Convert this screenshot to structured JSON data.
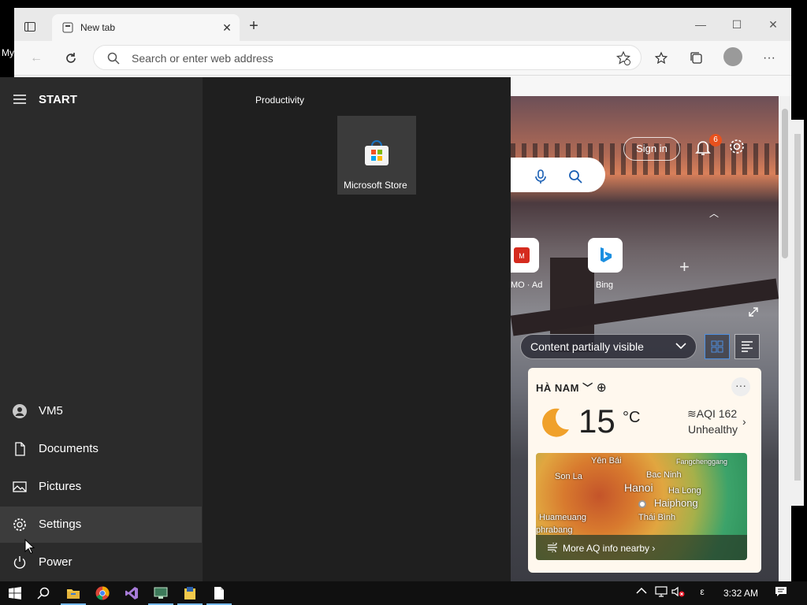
{
  "desktop": {
    "label_fragment": "My"
  },
  "browser": {
    "tab": {
      "title": "New tab"
    },
    "window_controls": {
      "minimize": "—",
      "maximize": "☐",
      "close": "✕"
    },
    "address_bar": {
      "placeholder": "Search or enter web address"
    },
    "page": {
      "sign_in": "Sign in",
      "notification_count": "6",
      "quick_links": [
        {
          "label": "MO · Ad"
        },
        {
          "label": "Bing"
        }
      ],
      "add_link": "+",
      "content_visibility": "Content partially visible",
      "weather": {
        "location": "HÀ NAM",
        "temperature": "15",
        "unit": "°C",
        "aqi": "AQI 162",
        "aqi_status": "Unhealthy",
        "more": "···",
        "map_labels": [
          "Yên Bái",
          "Fangchenggang",
          "Son La",
          "Bac Ninh",
          "Hanoi",
          "Ha Long",
          "Haiphong",
          "Huameuang",
          "Thái Bình",
          "phrabang"
        ],
        "map_cta": "More AQ info nearby ›"
      }
    }
  },
  "start_menu": {
    "title": "START",
    "group": "Productivity",
    "apps": [
      {
        "label": "Microsoft Store"
      }
    ],
    "items": [
      {
        "label": "VM5",
        "icon": "user-icon"
      },
      {
        "label": "Documents",
        "icon": "document-icon"
      },
      {
        "label": "Pictures",
        "icon": "pictures-icon"
      },
      {
        "label": "Settings",
        "icon": "gear-icon"
      },
      {
        "label": "Power",
        "icon": "power-icon"
      }
    ]
  },
  "taskbar": {
    "clock": "3:32 AM",
    "ime": "ε",
    "apps": [
      "start",
      "search",
      "file-explorer",
      "chrome",
      "visual-studio",
      "app-5",
      "app-6",
      "notepad"
    ]
  },
  "colors": {
    "accent": "#76b9ed",
    "start_bg": "#1f1f1f",
    "start_left_bg": "#2b2b2b",
    "taskbar_bg": "#101010",
    "badge": "#e8511d"
  }
}
